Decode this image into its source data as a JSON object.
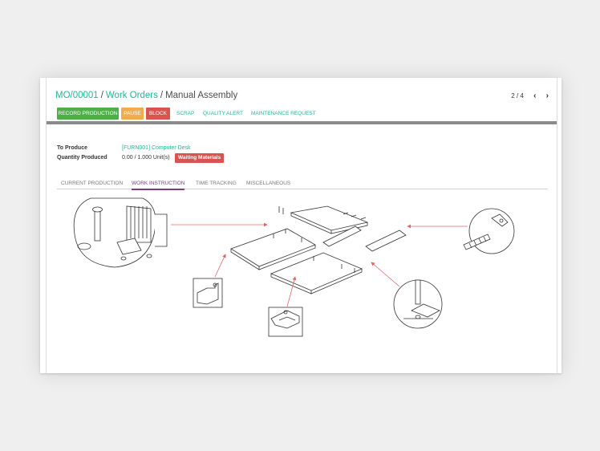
{
  "breadcrumb": {
    "mo": "MO/00001",
    "sep": "/",
    "work_orders": "Work Orders",
    "current": "Manual Assembly"
  },
  "pager": {
    "text": "2 / 4",
    "prev_icon": "chevron-left-icon",
    "next_icon": "chevron-right-icon"
  },
  "toolbar": {
    "record_production": "RECORD PRODUCTION",
    "pause": "PAUSE",
    "block": "BLOCK",
    "scrap": "SCRAP",
    "quality_alert": "QUALITY ALERT",
    "maintenance_request": "MAINTENANCE REQUEST"
  },
  "form": {
    "to_produce_label": "To Produce",
    "to_produce_value": "[FURN001] Computer Desk",
    "quantity_label": "Quantity Produced",
    "quantity_value": "0.00 / 1.000 Unit(s)",
    "status_badge": "Waiting Materials"
  },
  "tabs": [
    {
      "label": "CURRENT PRODUCTION"
    },
    {
      "label": "WORK INSTRUCTION"
    },
    {
      "label": "TIME TRACKING"
    },
    {
      "label": "MISCELLANEOUS"
    }
  ],
  "colors": {
    "accent": "#21b799",
    "record_production": "#4fae49",
    "pause": "#f0ad4e",
    "block": "#d9534f",
    "active_tab": "#7c3f7c",
    "arrow": "#e06666"
  }
}
